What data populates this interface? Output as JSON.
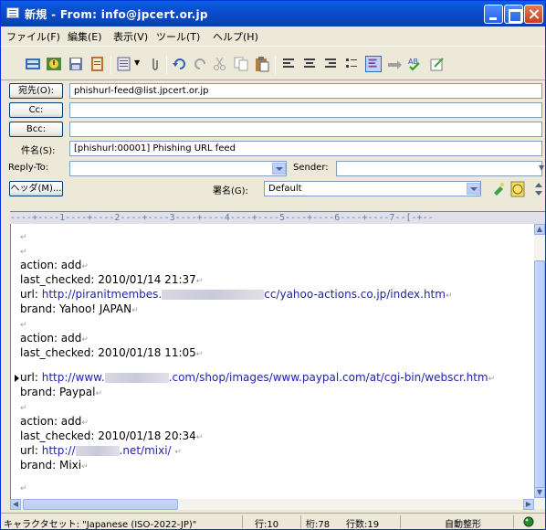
{
  "window": {
    "title": "新規 - From: info@jpcert.or.jp"
  },
  "menu": [
    "ファイル(F)",
    "編集(E)",
    "表示(V)",
    "ツール(T)",
    "ヘルプ(H)"
  ],
  "header": {
    "to_label": "宛先(O):",
    "to_value": "phishurl-feed@list.jpcert.or.jp",
    "cc_label": "Cc:",
    "cc_value": "",
    "bcc_label": "Bcc:",
    "bcc_value": "",
    "subject_label": "件名(S):",
    "subject_value": "[phishurl:00001] Phishing URL feed",
    "replyto_label": "Reply-To:",
    "replyto_value": "",
    "sender_label": "Sender:",
    "sender_value": "",
    "headers_button": "ヘッダ(M)...",
    "signature_label": "署名(G):",
    "signature_value": "Default"
  },
  "ruler": "----+----1----+----2----+----3----+----4----+----5----+----6----+----7--[-+--",
  "body": {
    "entries": [
      {
        "action": "action: add",
        "checked": "last_checked: 2010/01/14 21:37",
        "url_prefix": "url:",
        "url_a": "http://piranitmembes.",
        "url_b": "cc/yahoo-actions.co.jp/index.htm",
        "brand": "brand: Yahoo! JAPAN"
      },
      {
        "action": "action: add",
        "checked": "last_checked: 2010/01/18 11:05",
        "url_prefix": "url:",
        "url_a": "http://www.",
        "url_b": ".com/shop/images/www.paypal.com/at/cgi-bin/webscr.htm",
        "brand": "brand: Paypal"
      },
      {
        "action": "action: add",
        "checked": "last_checked: 2010/01/18 20:34",
        "url_prefix": "url:",
        "url_a": "http://",
        "url_b": ".net/mixi/",
        "brand": "brand: Mixi"
      }
    ]
  },
  "status": {
    "charset": "キャラクタセット: \"Japanese (ISO-2022-JP)\"",
    "row": "行:10",
    "col": "桁:78",
    "lines": "行数:19",
    "wrap": "自動整形"
  }
}
